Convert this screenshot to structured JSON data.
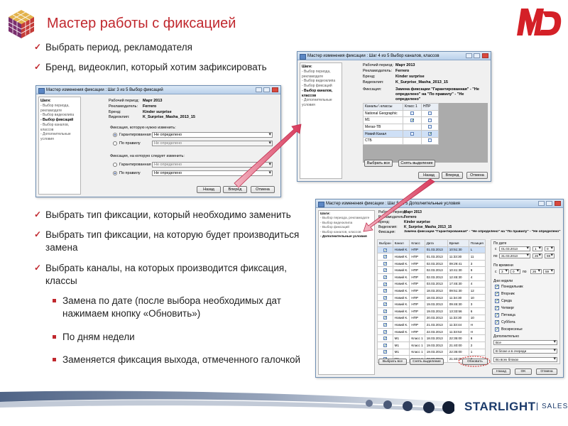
{
  "title": "Мастер работы с фиксацией",
  "brand": {
    "md": "MD",
    "starlight": "STARLIGHT",
    "sales": "SALES"
  },
  "bullets_top": [
    "Выбрать период, рекламодателя",
    "Бренд, видеоклип, который хотим зафиксировать"
  ],
  "bullets_bottom": [
    "Выбрать тип фиксации, который необходимо заменить",
    "Выбрать тип фиксации, на которую будет производиться замена",
    "Выбрать каналы, на которых производится фиксация, классы"
  ],
  "sub_bullets": [
    "Замена по дате (после выбора необходимых дат нажимаем кнопку «Обновить»)",
    "По дням недели",
    "Заменяется фиксация выхода, отмеченного галочкой"
  ],
  "steps": {
    "header": "Шаги:",
    "items": [
      "- Выбор периода, рекламодате",
      "- Выбор видеоклипа",
      "- Выбор фиксаций",
      "- Выбор каналов, классов",
      "- Дополнительные условия"
    ]
  },
  "info": {
    "period_label": "Рабочий период:",
    "period_value": "Март 2013",
    "advertiser_label": "Рекламодатель:",
    "advertiser_value": "Ferrero",
    "brand_label": "Бренд:",
    "brand_value": "Kinder surprise",
    "clip_label": "Видеоклип:",
    "clip_value": "K_Surprise_Masha_2013_15",
    "fix_label": "Фиксация:"
  },
  "win1": {
    "title": "Мастер изменения фиксации : Шаг 3 из 5 Выбор фиксаций",
    "from_group": "Фиксация, которую нужно изменить:",
    "to_group": "Фиксация, на которую следует изменить:",
    "opt_guaranteed": "Гарантированная",
    "opt_rule": "По правилу",
    "undefined": "Не определено",
    "btn_back": "Назад",
    "btn_next": "Вперед",
    "btn_cancel": "Отмена"
  },
  "win2": {
    "title": "Мастер изменения фиксации : Шаг 4 из 5 Выбор каналов, классов",
    "fix_value": "Замена фиксации \"Гарантированная\" - \"Не определено\" на \"По правилу\" - \"Не определено\"",
    "col_channels": "Каналы \\ классы",
    "col_class1": "Класс 1",
    "col_npr": "НПР",
    "channels": [
      "National Geographic",
      "М1",
      "Мегао-ТВ",
      "Новий Канал",
      "СТБ"
    ],
    "btn_select_all": "Выбрать все",
    "btn_clear": "Снять выделение",
    "btn_back": "Назад",
    "btn_next": "Вперед",
    "btn_cancel": "Отмена"
  },
  "win3": {
    "title": "Мастер изменения фиксации : Шаг 5 из 5 Дополнительные условия",
    "fix_value": "Замена фиксации \"Гарантированная\" - \"Не определено\" на \"По правилу\" - \"Не определено\"",
    "columns": [
      "Выбран",
      "Канал",
      "Класс",
      "Дата",
      "Время",
      "Позиция"
    ],
    "rows": [
      [
        "Новий К.",
        "НПР",
        "01.03.2013",
        "10:51:30",
        "L"
      ],
      [
        "Новий К.",
        "НПР",
        "01.03.2013",
        "11:33:30",
        "11"
      ],
      [
        "Новий К.",
        "НПР",
        "02.03.2013",
        "09:29:41",
        "3"
      ],
      [
        "Новий К.",
        "НПР",
        "02.03.2013",
        "10:41:30",
        "9"
      ],
      [
        "Новий К.",
        "НПР",
        "02.03.2013",
        "12:45:30",
        "4"
      ],
      [
        "Новий К.",
        "НПР",
        "03.03.2013",
        "17:45:30",
        "4"
      ],
      [
        "Новий К.",
        "НПР",
        "18.03.2013",
        "09:51:30",
        "12"
      ],
      [
        "Новий К.",
        "НПР",
        "18.03.2013",
        "11:34:30",
        "10"
      ],
      [
        "Новий К.",
        "НПР",
        "19.03.2013",
        "09:45:30",
        "3"
      ],
      [
        "Новий К.",
        "НПР",
        "19.03.2013",
        "13:33:56",
        "6"
      ],
      [
        "Новий К.",
        "НПР",
        "20.03.2013",
        "11:33:30",
        "10"
      ],
      [
        "Новий К.",
        "НПР",
        "21.03.2013",
        "11:33:44",
        "Н"
      ],
      [
        "Новий К.",
        "НПР",
        "22.03.2013",
        "11:33:53",
        "Н"
      ],
      [
        "М1",
        "Класс 1",
        "18.03.2013",
        "22:35:00",
        "8"
      ],
      [
        "М1",
        "Класс 1",
        "19.03.2013",
        "21:40:00",
        "2"
      ],
      [
        "М1",
        "Класс 1",
        "19.03.2013",
        "22:35:00",
        "1"
      ],
      [
        "М1",
        "Класс 1",
        "20.03.2013",
        "21:40:00",
        "2"
      ]
    ],
    "by_date": "По дате",
    "date_from_label": "с",
    "date_from": "01.03.2013",
    "time_from_h": "1",
    "time_from_m": "0",
    "date_to_label": "по",
    "date_to": "31.03.2013",
    "time_to_h": "26",
    "time_to_m": "59",
    "by_time": "По времени",
    "time_c": "с",
    "time_c_h": "3",
    "time_c_m": "0",
    "time_po": "по",
    "time_po_h": "26",
    "time_po_m": "59",
    "weekdays_label": "Дни недели",
    "weekdays": [
      "Понедельник",
      "Вторник",
      "Среда",
      "Четверг",
      "Пятница",
      "Суббота",
      "Воскресенье"
    ],
    "extra_label": "Дополнительно",
    "extra1": "Все",
    "extra2": "В блоке и в очереди",
    "extra3": "Во всех блоках",
    "btn_refresh": "Обновить",
    "btn_select_all": "Выбрать все",
    "btn_clear": "Снять выделение",
    "btn_back": "Назад",
    "btn_ok": "OK",
    "btn_cancel": "Отмена"
  }
}
